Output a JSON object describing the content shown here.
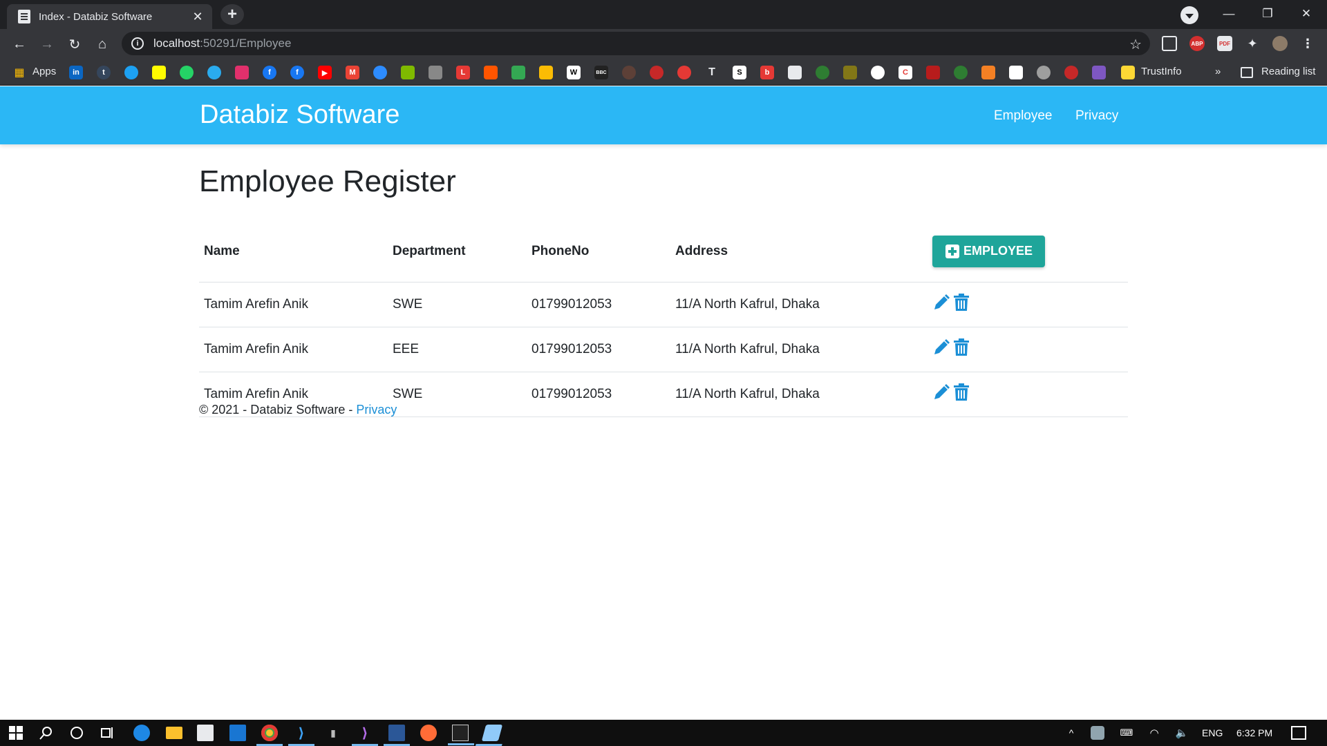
{
  "browser": {
    "tab_title": "Index - Databiz Software",
    "tab_close": "✕",
    "new_tab": "+",
    "url_host": "localhost",
    "url_rest": ":50291/Employee",
    "window_controls": {
      "minimize": "—",
      "restore": "❐",
      "close": "✕"
    },
    "nav": {
      "back": "←",
      "forward": "→",
      "reload": "↻",
      "home": "⌂",
      "star": "☆"
    },
    "bookmarks": {
      "apps_label": "Apps",
      "trustinfo_label": "TrustInfo",
      "more": "»",
      "reading_list_label": "Reading list"
    }
  },
  "site": {
    "brand": "Databiz Software",
    "nav": [
      {
        "label": "Employee"
      },
      {
        "label": "Privacy"
      }
    ]
  },
  "page": {
    "title": "Employee Register",
    "table": {
      "headers": {
        "name": "Name",
        "department": "Department",
        "phone": "PhoneNo",
        "address": "Address"
      },
      "add_button_label": "EMPLOYEE",
      "rows": [
        {
          "name": "Tamim Arefin Anik",
          "department": "SWE",
          "phone": "01799012053",
          "address": "11/A North Kafrul, Dhaka"
        },
        {
          "name": "Tamim Arefin Anik",
          "department": "EEE",
          "phone": "01799012053",
          "address": "11/A North Kafrul, Dhaka"
        },
        {
          "name": "Tamim Arefin Anik",
          "department": "SWE",
          "phone": "01799012053",
          "address": "11/A North Kafrul, Dhaka"
        }
      ]
    }
  },
  "footer": {
    "text": "© 2021 - Databiz Software - ",
    "link": "Privacy"
  },
  "taskbar": {
    "language": "ENG",
    "time": "6:32 PM"
  },
  "colors": {
    "navbar": "#2bb7f5",
    "add_button": "#1fa59a",
    "action_icons": "#1b8fd6",
    "link": "#1b8fd6"
  }
}
